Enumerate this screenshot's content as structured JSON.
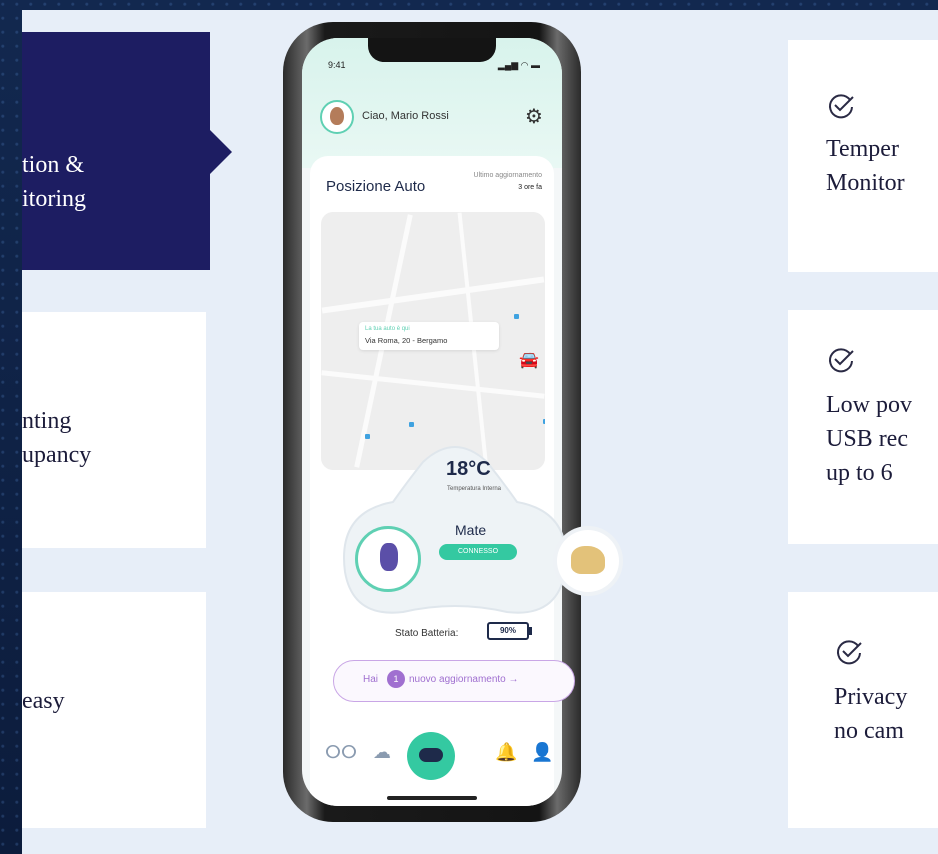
{
  "left_column": {
    "box1_lines": [
      "tion &",
      "itoring"
    ],
    "box2_lines": [
      "nting",
      "upancy"
    ],
    "box3_lines": [
      "easy"
    ]
  },
  "right_column": {
    "card1_lines": [
      "Temper",
      "Monitor"
    ],
    "card2_lines": [
      "Low pov",
      "USB rec",
      "up to 6"
    ],
    "card3_lines": [
      "Privacy",
      "no cam"
    ]
  },
  "app": {
    "time": "9:41",
    "greeting": "Ciao, Mario Rossi",
    "section_title": "Posizione Auto",
    "last_update_label": "Ultimo aggiornamento",
    "last_update_value": "3 ore fa",
    "address_label": "La tua auto è qui",
    "address": "Via Roma, 20 - Bergamo",
    "temperature": "18°C",
    "temperature_label": "Temperatura Interna",
    "device_name": "Mate",
    "device_status": "CONNESSO",
    "battery_label": "Stato Batteria:",
    "battery_value": "90%",
    "update_prefix": "Hai",
    "update_count": "1",
    "update_suffix": "nuovo aggiornamento →"
  },
  "colors": {
    "accent_teal": "#34c9a1",
    "accent_purple": "#a070d0",
    "navy": "#1d1d62"
  }
}
